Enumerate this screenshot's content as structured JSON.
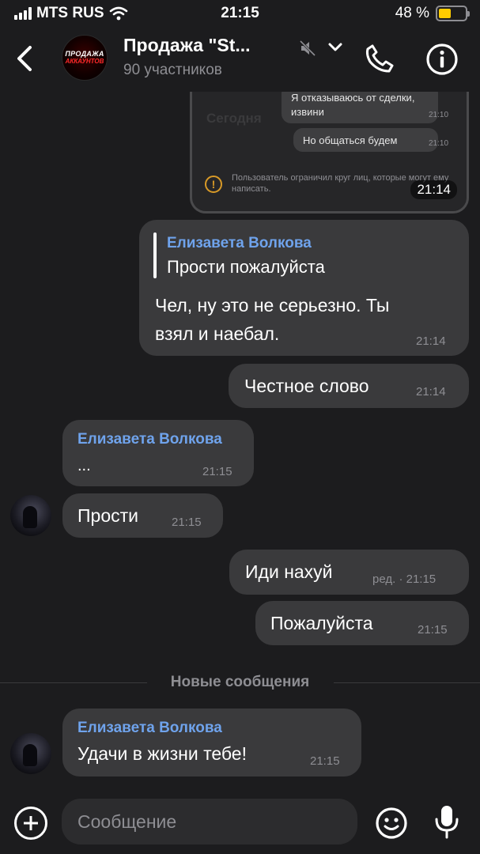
{
  "status_bar": {
    "carrier": "MTS RUS",
    "time": "21:15",
    "battery": "48 %",
    "battery_level": 0.48
  },
  "header": {
    "title": "Продажа \"St...",
    "subtitle": "90 участников",
    "avatar_line1": "ПРОДАЖА",
    "avatar_line2": "АККАУНТОВ"
  },
  "screenshot": {
    "today_label": "Сегодня",
    "msg1_line1": "Я отказываюсь от сделки,",
    "msg1_line2": "извини",
    "msg1_time": "21:10",
    "msg2": "Но общаться будем",
    "msg2_time": "21:10",
    "warning_icon": "!",
    "warning_text": "Пользователь ограничил круг лиц, которые могут ему написать.",
    "stamp": "21:14"
  },
  "messages": {
    "m1": {
      "reply_name": "Елизавета Волкова",
      "reply_text": "Прости пожалуйста",
      "line1": "Чел, ну это не серьезно. Ты",
      "line2": "взял и наебал.",
      "time": "21:14"
    },
    "m2": {
      "text": "Честное слово",
      "time": "21:14"
    },
    "m3": {
      "name": "Елизавета Волкова",
      "text": "...",
      "time": "21:15"
    },
    "m4": {
      "text": "Прости",
      "time": "21:15"
    },
    "m5": {
      "text": "Иди нахуй",
      "meta": "ред. · 21:15"
    },
    "m6": {
      "text": "Пожалуйста",
      "time": "21:15"
    },
    "m7": {
      "name": "Елизавета Волкова",
      "text": "Удачи в жизни тебе!",
      "time": "21:15"
    }
  },
  "divider": {
    "label": "Новые сообщения"
  },
  "composer": {
    "placeholder": "Сообщение"
  },
  "colors": {
    "background": "#1c1c1e",
    "bubble": "#3a3a3c",
    "name": "#6fa3ec",
    "battery": "#ffcc00"
  },
  "icons": [
    "back-icon",
    "mute-icon",
    "chevron-down-icon",
    "phone-icon",
    "info-icon",
    "warning-icon",
    "plus-icon",
    "emoji-icon",
    "mic-icon"
  ]
}
